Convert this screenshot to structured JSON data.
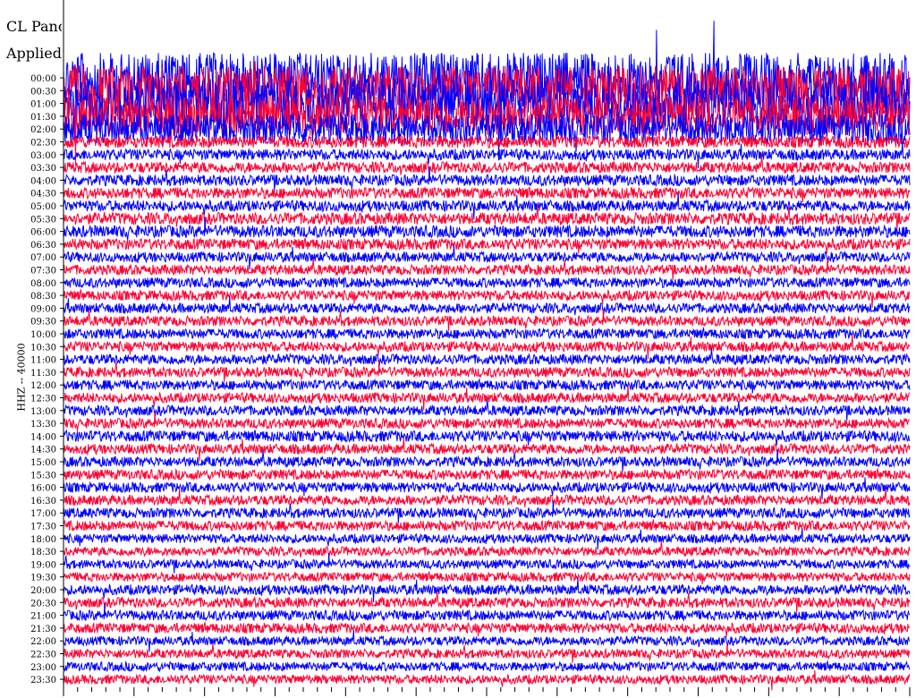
{
  "header": {
    "title": "CL Panc",
    "subtitle": "Applied"
  },
  "colors": {
    "trace_a": "#0000ff",
    "trace_b": "#ff0033",
    "background": "#ffffff",
    "text": "#000000"
  },
  "chart_data": {
    "type": "line",
    "title": "CL Panc",
    "subtitle": "Applied",
    "ylabel": "HHZ -- 40000",
    "xlabel": "",
    "row_interval_minutes": 30,
    "rows": 48,
    "trace_colors_alternating": [
      "blue",
      "red"
    ],
    "y_tick_labels": [
      "00:00",
      "00:30",
      "01:00",
      "01:30",
      "02:00",
      "02:30",
      "03:00",
      "03:30",
      "04:00",
      "04:30",
      "05:00",
      "05:30",
      "06:00",
      "06:30",
      "07:00",
      "07:30",
      "08:00",
      "08:30",
      "09:00",
      "09:30",
      "10:00",
      "10:30",
      "11:00",
      "11:30",
      "12:00",
      "12:30",
      "13:00",
      "13:30",
      "14:00",
      "14:30",
      "15:00",
      "15:30",
      "16:00",
      "16:30",
      "17:00",
      "17:30",
      "18:00",
      "18:30",
      "19:00",
      "19:30",
      "20:00",
      "20:30",
      "21:00",
      "21:30",
      "22:00",
      "22:30",
      "23:00",
      "23:30"
    ],
    "noise_level_by_row": [
      5,
      5,
      5,
      4,
      3,
      1.2,
      1.1,
      1.1,
      1.1,
      1.1,
      1.1,
      1.2,
      1.2,
      1.1,
      1.0,
      1.0,
      1.0,
      1.0,
      1.0,
      1.0,
      1.0,
      1.0,
      1.0,
      1.0,
      1.0,
      1.0,
      1.0,
      1.0,
      1.1,
      1.0,
      1.0,
      1.0,
      1.0,
      1.0,
      1.0,
      1.0,
      0.9,
      0.9,
      0.9,
      0.9,
      1.0,
      1.0,
      1.0,
      1.0,
      0.9,
      0.9,
      0.9,
      0.9
    ],
    "grid": false,
    "legend": "none"
  }
}
